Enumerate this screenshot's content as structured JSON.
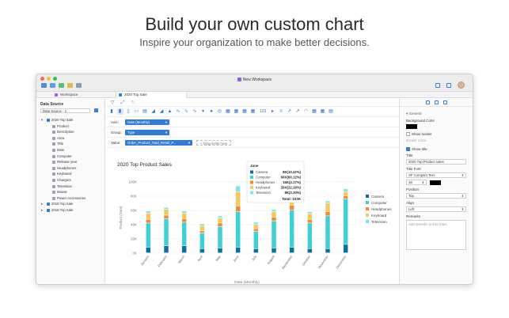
{
  "hero": {
    "title": "Build your own custom chart",
    "subtitle": "Inspire your organization to make better decisions."
  },
  "window": {
    "title": "New Workspace",
    "colors": {
      "close": "#fe5f57",
      "minimize": "#febc2e",
      "zoom": "#28c840",
      "accent": "#2f7bd9"
    }
  },
  "tabs": {
    "workspace": "Workspace",
    "active": "2020 Top Sale"
  },
  "left_panel": {
    "heading": "Data Source",
    "selected_source": "Data Source - 1",
    "tree": [
      {
        "label": "2020 Top Sale",
        "level": 0,
        "expanded": true,
        "icon": "table-icon"
      },
      {
        "label": "Product",
        "level": 1,
        "icon": "text-field-icon"
      },
      {
        "label": "Description",
        "level": 1,
        "icon": "text-field-icon"
      },
      {
        "label": "Area",
        "level": 1,
        "icon": "text-field-icon"
      },
      {
        "label": "Title",
        "level": 1,
        "icon": "text-field-icon"
      },
      {
        "label": "Date",
        "level": 1,
        "icon": "date-field-icon"
      },
      {
        "label": "Computer",
        "level": 1,
        "icon": "number-field-icon"
      },
      {
        "label": "Release year",
        "level": 1,
        "icon": "number-field-icon"
      },
      {
        "label": "Headphones",
        "level": 1,
        "icon": "number-field-icon"
      },
      {
        "label": "Keyboard",
        "level": 1,
        "icon": "number-field-icon"
      },
      {
        "label": "Chargers",
        "level": 1,
        "icon": "number-field-icon"
      },
      {
        "label": "Television",
        "level": 1,
        "icon": "number-field-icon"
      },
      {
        "label": "Mouse",
        "level": 1,
        "icon": "number-field-icon"
      },
      {
        "label": "Power Accessories",
        "level": 1,
        "icon": "number-field-icon"
      },
      {
        "label": "2019 Top Sale",
        "level": 0,
        "expanded": false,
        "icon": "table-icon"
      },
      {
        "label": "2018 Top Sale",
        "level": 0,
        "expanded": false,
        "icon": "table-icon"
      }
    ]
  },
  "fields": {
    "axis_label": "Axis:",
    "axis_value": "Date (Monthly)",
    "group_label": "Group:",
    "group_value": "Type",
    "value_label": "Value:",
    "value_value": "Order_Product_Total_Retail_P...",
    "drag_hint": "+ Drag fields here"
  },
  "tooltip": {
    "title": "June",
    "rows": [
      {
        "name": "Camera",
        "value": "8K(10.22%)"
      },
      {
        "name": "Computer",
        "value": "50K(60.12%)"
      },
      {
        "name": "Headphones",
        "value": "15K(4.17%)"
      },
      {
        "name": "Keyboard",
        "value": "20K(22.19%)"
      },
      {
        "name": "Television",
        "value": "8K(3.30%)"
      }
    ],
    "total": "Total: 103K"
  },
  "chart_data": {
    "type": "bar",
    "stacked": true,
    "title": "2020 Top Product Sales",
    "xlabel": "Date (Monthly)",
    "ylabel": "Product (Sum)",
    "ylim": [
      0,
      100000
    ],
    "yticks": [
      "0K",
      "20K",
      "40K",
      "60K",
      "80K",
      "100K"
    ],
    "categories": [
      "January",
      "February",
      "March",
      "April",
      "May",
      "June",
      "July",
      "August",
      "September",
      "October",
      "November",
      "December"
    ],
    "series": [
      {
        "name": "Camera",
        "color": "#0e6f9c",
        "values": [
          8000,
          10000,
          10000,
          6000,
          7000,
          8000,
          6000,
          7000,
          8000,
          6000,
          6000,
          12000
        ]
      },
      {
        "name": "Computer",
        "color": "#3fd0d6",
        "values": [
          34000,
          38000,
          33000,
          22000,
          30000,
          50000,
          24000,
          38000,
          52000,
          36000,
          46000,
          64000
        ]
      },
      {
        "name": "Headphones",
        "color": "#f08c2e",
        "values": [
          5000,
          5000,
          5000,
          3000,
          5000,
          8000,
          4000,
          5000,
          7000,
          5000,
          6000,
          4000
        ]
      },
      {
        "name": "Keyboard",
        "color": "#f7c85a",
        "values": [
          9000,
          8000,
          8000,
          7000,
          7000,
          20000,
          6000,
          8000,
          10000,
          8000,
          12000,
          6000
        ]
      },
      {
        "name": "Television",
        "color": "#7fe6ea",
        "values": [
          3000,
          3000,
          3000,
          3000,
          3000,
          8000,
          3000,
          3000,
          4000,
          3000,
          3000,
          4000
        ]
      }
    ],
    "legend": "right"
  },
  "right_panel": {
    "section": "General",
    "background_color": "Background Color",
    "show_border": "Show border",
    "border_color": "Border Color",
    "show_title": "Show title",
    "title_label": "Title",
    "title_value": "2020 Top Product sales",
    "title_font": "Title Font",
    "font_value": "SF Compact Text",
    "font_size": "18",
    "position_label": "Position",
    "position_value": "Top",
    "align_label": "Align",
    "align_value": "Left",
    "remarks_label": "Remarks",
    "remarks_placeholder": "Add remarks to this chart..."
  }
}
